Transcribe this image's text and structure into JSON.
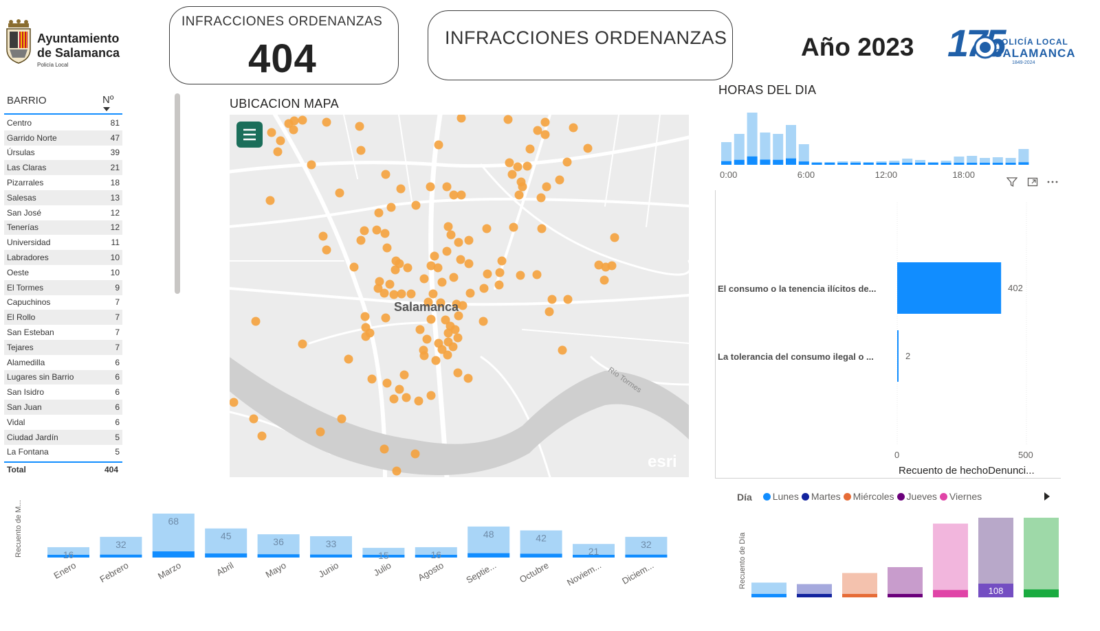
{
  "header": {
    "logo_left": {
      "line1": "Ayuntamiento",
      "line2": "de Salamanca",
      "line3": "Policía Local"
    },
    "kpi_card": {
      "title": "INFRACCIONES ORDENANZAS",
      "value": "404"
    },
    "title_card": {
      "title": "INFRACCIONES ORDENANZAS"
    },
    "year": "Año 2023",
    "logo_right": {
      "number": "175",
      "line1": "POLICÍA LOCAL",
      "line2": "SALAMANCA",
      "line3": "1849-2024"
    }
  },
  "barrio_table": {
    "col_barrio": "BARRIO",
    "col_num": "Nº",
    "rows": [
      {
        "name": "Centro",
        "n": 81
      },
      {
        "name": "Garrido Norte",
        "n": 47
      },
      {
        "name": "Úrsulas",
        "n": 39
      },
      {
        "name": "Las Claras",
        "n": 21
      },
      {
        "name": "Pizarrales",
        "n": 18
      },
      {
        "name": "Salesas",
        "n": 13
      },
      {
        "name": "San José",
        "n": 12
      },
      {
        "name": "Tenerías",
        "n": 12
      },
      {
        "name": "Universidad",
        "n": 11
      },
      {
        "name": "Labradores",
        "n": 10
      },
      {
        "name": "Oeste",
        "n": 10
      },
      {
        "name": "El Tormes",
        "n": 9
      },
      {
        "name": "Capuchinos",
        "n": 7
      },
      {
        "name": "El Rollo",
        "n": 7
      },
      {
        "name": "San Esteban",
        "n": 7
      },
      {
        "name": "Tejares",
        "n": 7
      },
      {
        "name": "Alamedilla",
        "n": 6
      },
      {
        "name": "Lugares sin Barrio",
        "n": 6
      },
      {
        "name": "San Isidro",
        "n": 6
      },
      {
        "name": "San Juan",
        "n": 6
      },
      {
        "name": "Vidal",
        "n": 6
      },
      {
        "name": "Ciudad Jardín",
        "n": 5
      },
      {
        "name": "La Fontana",
        "n": 5
      }
    ],
    "total_label": "Total",
    "total_value": "404"
  },
  "map": {
    "title": "UBICACION MAPA",
    "city_label": "Salamanca",
    "river_label": "Río Tormes",
    "attribution": "esri",
    "menu_icon": "hamburger-icon",
    "point_color": "#f4a340",
    "points": [
      [
        395,
        193
      ],
      [
        428,
        176
      ],
      [
        420,
        180
      ],
      [
        427,
        189
      ],
      [
        408,
        205
      ],
      [
        404,
        221
      ],
      [
        475,
        178
      ],
      [
        523,
        184
      ],
      [
        453,
        240
      ],
      [
        393,
        292
      ],
      [
        525,
        219
      ],
      [
        561,
        254
      ],
      [
        583,
        275
      ],
      [
        626,
        272
      ],
      [
        638,
        211
      ],
      [
        671,
        172
      ],
      [
        739,
        174
      ],
      [
        782,
        190
      ],
      [
        793,
        178
      ],
      [
        793,
        196
      ],
      [
        834,
        186
      ],
      [
        855,
        216
      ],
      [
        771,
        217
      ],
      [
        741,
        237
      ],
      [
        753,
        243
      ],
      [
        767,
        242
      ],
      [
        745,
        254
      ],
      [
        758,
        265
      ],
      [
        760,
        272
      ],
      [
        795,
        272
      ],
      [
        814,
        262
      ],
      [
        825,
        236
      ],
      [
        787,
        288
      ],
      [
        755,
        284
      ],
      [
        650,
        272
      ],
      [
        660,
        284
      ],
      [
        671,
        284
      ],
      [
        605,
        299
      ],
      [
        569,
        302
      ],
      [
        551,
        310
      ],
      [
        494,
        281
      ],
      [
        548,
        335
      ],
      [
        530,
        336
      ],
      [
        525,
        350
      ],
      [
        470,
        344
      ],
      [
        475,
        364
      ],
      [
        560,
        340
      ],
      [
        563,
        361
      ],
      [
        515,
        389
      ],
      [
        576,
        380
      ],
      [
        581,
        384
      ],
      [
        593,
        390
      ],
      [
        575,
        393
      ],
      [
        632,
        373
      ],
      [
        627,
        387
      ],
      [
        637,
        390
      ],
      [
        652,
        330
      ],
      [
        656,
        342
      ],
      [
        667,
        353
      ],
      [
        682,
        350
      ],
      [
        650,
        366
      ],
      [
        670,
        378
      ],
      [
        682,
        384
      ],
      [
        708,
        333
      ],
      [
        747,
        331
      ],
      [
        788,
        333
      ],
      [
        730,
        380
      ],
      [
        709,
        399
      ],
      [
        727,
        397
      ],
      [
        757,
        401
      ],
      [
        781,
        400
      ],
      [
        726,
        415
      ],
      [
        704,
        420
      ],
      [
        660,
        404
      ],
      [
        643,
        411
      ],
      [
        617,
        406
      ],
      [
        598,
        428
      ],
      [
        584,
        428
      ],
      [
        573,
        429
      ],
      [
        559,
        427
      ],
      [
        552,
        410
      ],
      [
        550,
        420
      ],
      [
        567,
        414
      ],
      [
        684,
        427
      ],
      [
        630,
        428
      ],
      [
        623,
        440
      ],
      [
        641,
        441
      ],
      [
        664,
        443
      ],
      [
        673,
        445
      ],
      [
        667,
        460
      ],
      [
        648,
        466
      ],
      [
        655,
        475
      ],
      [
        662,
        480
      ],
      [
        652,
        485
      ],
      [
        627,
        465
      ],
      [
        611,
        480
      ],
      [
        621,
        494
      ],
      [
        638,
        500
      ],
      [
        652,
        498
      ],
      [
        666,
        492
      ],
      [
        651,
        517
      ],
      [
        617,
        518
      ],
      [
        634,
        525
      ],
      [
        643,
        509
      ],
      [
        616,
        510
      ],
      [
        659,
        505
      ],
      [
        703,
        468
      ],
      [
        803,
        436
      ],
      [
        826,
        436
      ],
      [
        799,
        454
      ],
      [
        894,
        346
      ],
      [
        871,
        386
      ],
      [
        881,
        389
      ],
      [
        890,
        387
      ],
      [
        879,
        408
      ],
      [
        818,
        510
      ],
      [
        561,
        463
      ],
      [
        531,
        461
      ],
      [
        538,
        485
      ],
      [
        532,
        477
      ],
      [
        532,
        490
      ],
      [
        372,
        468
      ],
      [
        440,
        501
      ],
      [
        507,
        523
      ],
      [
        541,
        552
      ],
      [
        563,
        558
      ],
      [
        588,
        546
      ],
      [
        581,
        567
      ],
      [
        573,
        581
      ],
      [
        591,
        579
      ],
      [
        609,
        584
      ],
      [
        627,
        576
      ],
      [
        666,
        543
      ],
      [
        681,
        551
      ],
      [
        340,
        586
      ],
      [
        369,
        610
      ],
      [
        381,
        635
      ],
      [
        466,
        629
      ],
      [
        497,
        610
      ],
      [
        559,
        654
      ],
      [
        604,
        661
      ],
      [
        577,
        686
      ],
      [
        440,
        175
      ]
    ]
  },
  "colors": {
    "bar_light": "#a9d5f7",
    "bar_dark": "#118dff",
    "accent_teal": "#1b6e5a"
  },
  "chart_data": [
    {
      "id": "horas",
      "type": "bar",
      "title": "HORAS DEL DIA",
      "x_ticks": [
        "0:00",
        "6:00",
        "12:00",
        "18:00"
      ],
      "categories": [
        "0",
        "1",
        "2",
        "3",
        "4",
        "5",
        "6",
        "7",
        "8",
        "9",
        "10",
        "11",
        "12",
        "13",
        "14",
        "15",
        "16",
        "17",
        "18",
        "19",
        "20",
        "21",
        "22",
        "23"
      ],
      "values": [
        33,
        45,
        76,
        47,
        45,
        58,
        30,
        4,
        4,
        5,
        5,
        4,
        5,
        6,
        9,
        7,
        4,
        6,
        12,
        13,
        10,
        11,
        10,
        23
      ]
    },
    {
      "id": "tipo",
      "type": "bar",
      "orientation": "horizontal",
      "categories": [
        "El consumo o la tenencia ilícitos de...",
        "La tolerancia del consumo ilegal o ..."
      ],
      "values": [
        402,
        2
      ],
      "xlabel": "Recuento de hechoDenunci...",
      "x_ticks": [
        "0",
        "500"
      ],
      "xlim": [
        0,
        500
      ],
      "icons": [
        "filter-icon",
        "focus-mode-icon",
        "more-options-icon"
      ]
    },
    {
      "id": "meses",
      "type": "bar",
      "ylabel": "Recuento de M...",
      "categories": [
        "Enero",
        "Febrero",
        "Marzo",
        "Abril",
        "Mayo",
        "Junio",
        "Julio",
        "Agosto",
        "Septie...",
        "Octubre",
        "Noviem...",
        "Diciem..."
      ],
      "values": [
        16,
        32,
        68,
        45,
        36,
        33,
        15,
        16,
        48,
        42,
        21,
        32
      ]
    },
    {
      "id": "dias",
      "type": "bar",
      "ylabel": "Recuento de Día",
      "legend_title": "Día",
      "series": [
        {
          "name": "Lunes",
          "value": 20,
          "light": "#a9d5f7",
          "dark": "#118dff"
        },
        {
          "name": "Martes",
          "value": 18,
          "light": "#a5a9dd",
          "dark": "#12239e"
        },
        {
          "name": "Miércoles",
          "value": 33,
          "light": "#f4c2ae",
          "dark": "#e66c37"
        },
        {
          "name": "Jueves",
          "value": 41,
          "light": "#c89ccc",
          "dark": "#6b007b"
        },
        {
          "name": "Viernes",
          "value": 100,
          "light": "#f2b6dd",
          "dark": "#e044a7"
        },
        {
          "name": "",
          "value": 108,
          "light": "#b8a8c9",
          "dark": "#744ec2"
        },
        {
          "name": "",
          "value": 108,
          "light": "#9ed9a8",
          "dark": "#1aab40"
        }
      ],
      "data_labels": {
        "5": "108"
      },
      "legend_arrow_icon": "caret-right-icon"
    }
  ]
}
